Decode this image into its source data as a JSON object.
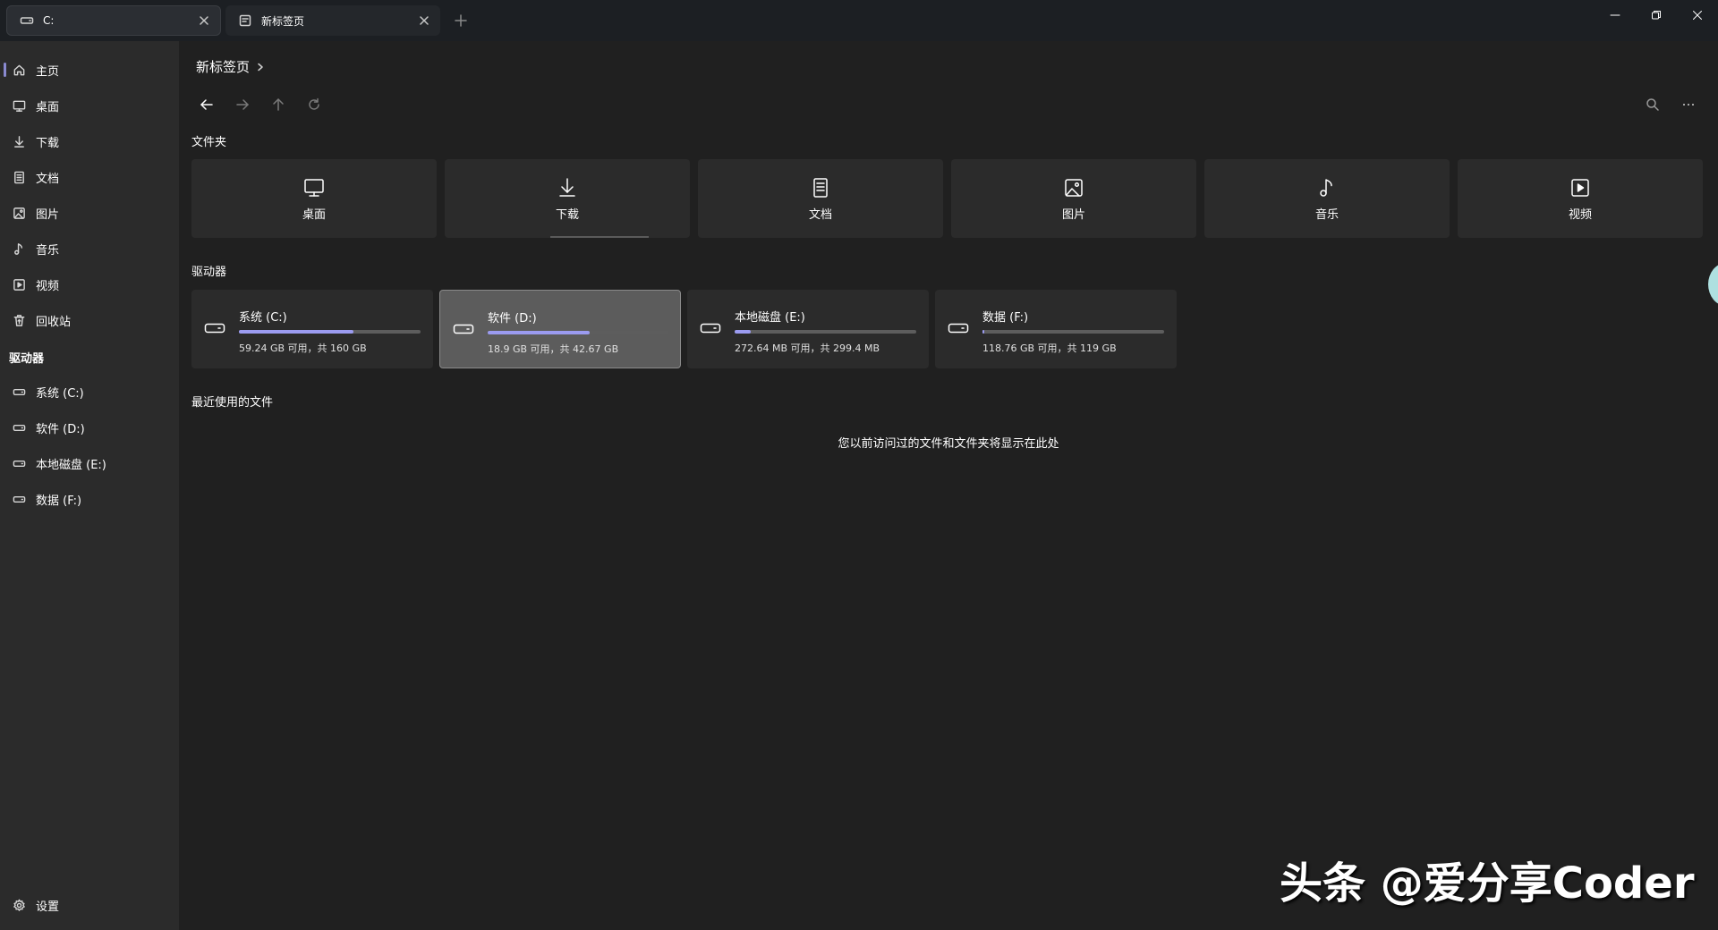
{
  "tabs": [
    {
      "label": "C:",
      "icon": "drive-icon"
    },
    {
      "label": "新标签页",
      "icon": "page-icon"
    }
  ],
  "sidebar": {
    "items": [
      {
        "label": "主页",
        "icon": "home-icon",
        "active": true
      },
      {
        "label": "桌面",
        "icon": "desktop-icon"
      },
      {
        "label": "下载",
        "icon": "download-icon"
      },
      {
        "label": "文档",
        "icon": "document-icon"
      },
      {
        "label": "图片",
        "icon": "picture-icon"
      },
      {
        "label": "音乐",
        "icon": "music-icon"
      },
      {
        "label": "视频",
        "icon": "video-icon"
      },
      {
        "label": "回收站",
        "icon": "recycle-bin-icon"
      }
    ],
    "drives_section": "驱动器",
    "drives": [
      {
        "label": "系统 (C:)"
      },
      {
        "label": "软件 (D:)"
      },
      {
        "label": "本地磁盘 (E:)"
      },
      {
        "label": "数据 (F:)"
      }
    ],
    "settings_label": "设置"
  },
  "main": {
    "breadcrumb": "新标签页",
    "folders_title": "文件夹",
    "folders": [
      {
        "label": "桌面",
        "icon": "desktop-icon"
      },
      {
        "label": "下载",
        "icon": "download-icon"
      },
      {
        "label": "文档",
        "icon": "document-icon"
      },
      {
        "label": "图片",
        "icon": "picture-icon"
      },
      {
        "label": "音乐",
        "icon": "music-icon"
      },
      {
        "label": "视频",
        "icon": "video-icon"
      }
    ],
    "drives_title": "驱动器",
    "drives": [
      {
        "name": "系统 (C:)",
        "usage": "59.24 GB 可用，共 160 GB",
        "used_fraction": 0.63
      },
      {
        "name": "软件 (D:)",
        "usage": "18.9 GB 可用，共 42.67 GB",
        "used_fraction": 0.56
      },
      {
        "name": "本地磁盘 (E:)",
        "usage": "272.64 MB 可用，共 299.4 MB",
        "used_fraction": 0.09
      },
      {
        "name": "数据 (F:)",
        "usage": "118.76 GB 可用，共 119 GB",
        "used_fraction": 0.01
      }
    ],
    "recent_title": "最近使用的文件",
    "recent_empty": "您以前访问过的文件和文件夹将显示在此处"
  },
  "colors": {
    "accent": "#9b9bf0",
    "background": "#202020",
    "sidebar": "#2b2b2b",
    "card": "#2b2b2b"
  },
  "watermark": "头条 @爱分享Coder"
}
